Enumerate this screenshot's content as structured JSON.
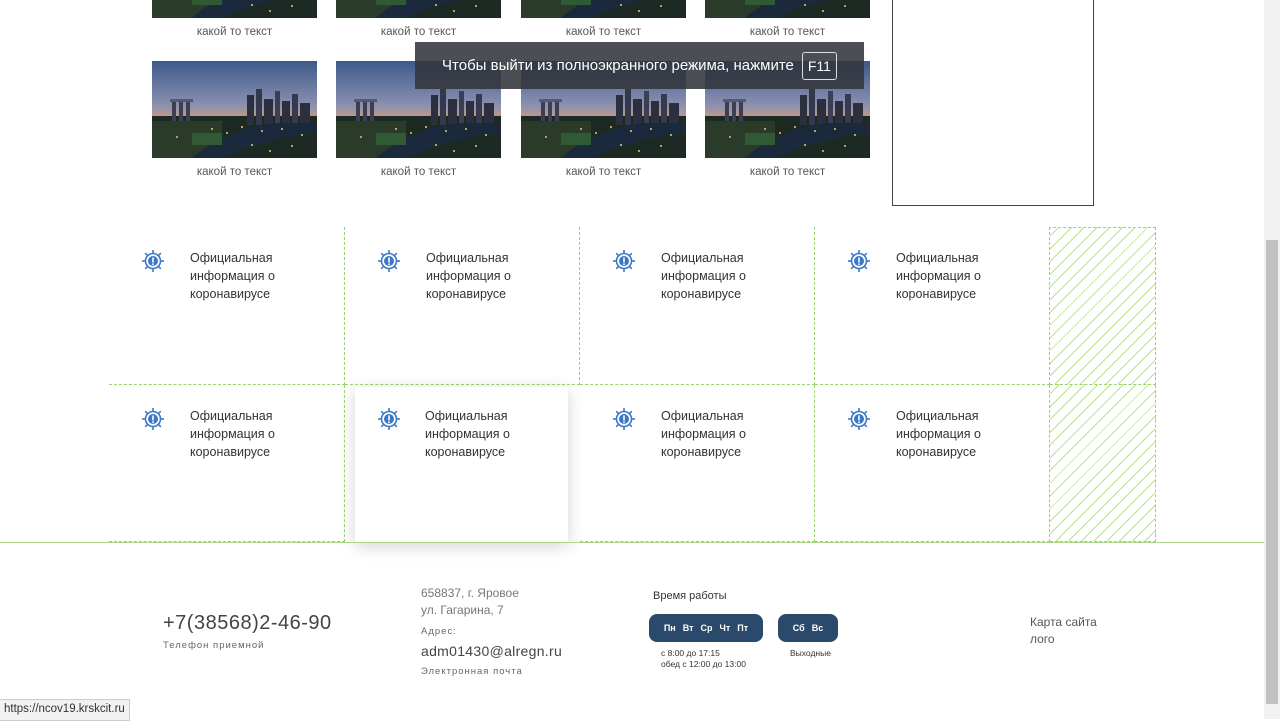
{
  "gallery": {
    "captions_row1": [
      "какой то текст",
      "какой то текст",
      "какой то текст",
      "какой то текст"
    ],
    "captions_row2": [
      "какой то текст",
      "какой то текст",
      "какой то текст",
      "какой то текст"
    ]
  },
  "fullscreen_tip": {
    "text": "Чтобы выйти из полноэкранного режима, нажмите",
    "key": "F11"
  },
  "info_cards": [
    "Официальная информация о коронавирусе",
    "Официальная информация о коронавирусе",
    "Официальная информация о коронавирусе",
    "Официальная информация о коронавирусе",
    "Официальная информация о коронавирусе",
    "Официальная информация о коронавирусе",
    "Официальная информация о коронавирусе",
    "Официальная информация о коронавирусе"
  ],
  "footer": {
    "phone": "+7(38568)2-46-90",
    "phone_label": "Телефон приемной",
    "address_line1": "658837, г. Яровое",
    "address_line2": "ул. Гагарина, 7",
    "address_label": "Адрес:",
    "email": "adm01430@alregn.ru",
    "email_label": "Электронная почта",
    "hours_title": "Время работы",
    "weekdays": [
      "Пн",
      "Вт",
      "Ср",
      "Чт",
      "Пт"
    ],
    "weekend": [
      "Сб",
      "Вс"
    ],
    "weekday_hours_1": "с 8:00 до 17:15",
    "weekday_hours_2": "обед с 12:00 до 13:00",
    "weekend_label": "Выходные",
    "sitemap": "Карта сайта",
    "logo": "лого"
  },
  "status_url": "https://ncov19.krskcit.ru",
  "colors": {
    "grid_dash": "#9ad36a",
    "days_bg": "#2b4a6b",
    "icon_blue": "#3a78c8"
  }
}
